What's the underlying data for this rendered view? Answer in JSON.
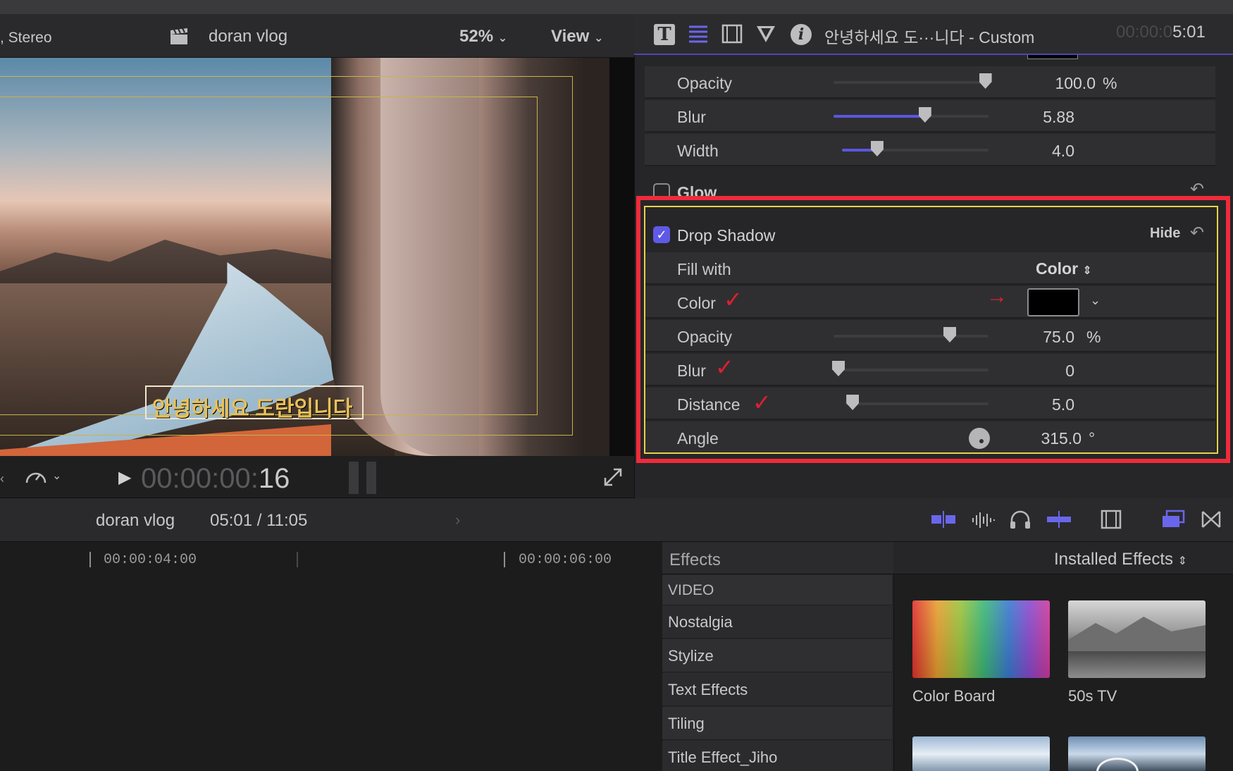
{
  "viewer": {
    "audio_label": ", Stereo",
    "project_name": "doran vlog",
    "zoom": "52%",
    "view_menu": "View",
    "title_overlay_text": "안녕하세요 도란입니다",
    "timecode_dim": "00:00:00:",
    "timecode_frames": "16"
  },
  "inspector": {
    "clip_title": "안녕하세요 도···니다 - Custom",
    "timecode_dim": "00:00:0",
    "timecode": "5:01",
    "outline": {
      "opacity_label": "Opacity",
      "opacity_value": "100.0",
      "opacity_unit": "%",
      "opacity_level": 0.98,
      "blur_label": "Blur",
      "blur_value": "5.88",
      "blur_level": 0.59,
      "width_label": "Width",
      "width_value": "4.0",
      "width_level": 0.24
    },
    "glow": {
      "label": "Glow",
      "enabled": false
    },
    "drop_shadow": {
      "label": "Drop Shadow",
      "enabled": true,
      "hide_label": "Hide",
      "fill_with_label": "Fill with",
      "fill_with_value": "Color",
      "color_label": "Color",
      "color_swatch": "#000000",
      "opacity_label": "Opacity",
      "opacity_value": "75.0",
      "opacity_unit": "%",
      "opacity_level": 0.75,
      "blur_label": "Blur",
      "blur_value": "0",
      "blur_level": 0.0,
      "distance_label": "Distance",
      "distance_value": "5.0",
      "distance_level": 0.05,
      "angle_label": "Angle",
      "angle_value": "315.0",
      "angle_unit": "°"
    }
  },
  "timeline": {
    "project_name": "doran vlog",
    "position": "05:01 / 11:05",
    "ruler": [
      "00:00:04:00",
      "00:00:06:00"
    ]
  },
  "effects": {
    "title": "Effects",
    "category": "VIDEO",
    "items": [
      "Nostalgia",
      "Stylize",
      "Text Effects",
      "Tiling",
      "Title Effect_Jiho"
    ],
    "filter_menu": "Installed Effects",
    "thumbnails": [
      "Color Board",
      "50s TV"
    ]
  },
  "colors": {
    "accent": "#5e5ae6",
    "highlight_red": "#ef2b3a",
    "highlight_yellow": "#e8d24a"
  }
}
